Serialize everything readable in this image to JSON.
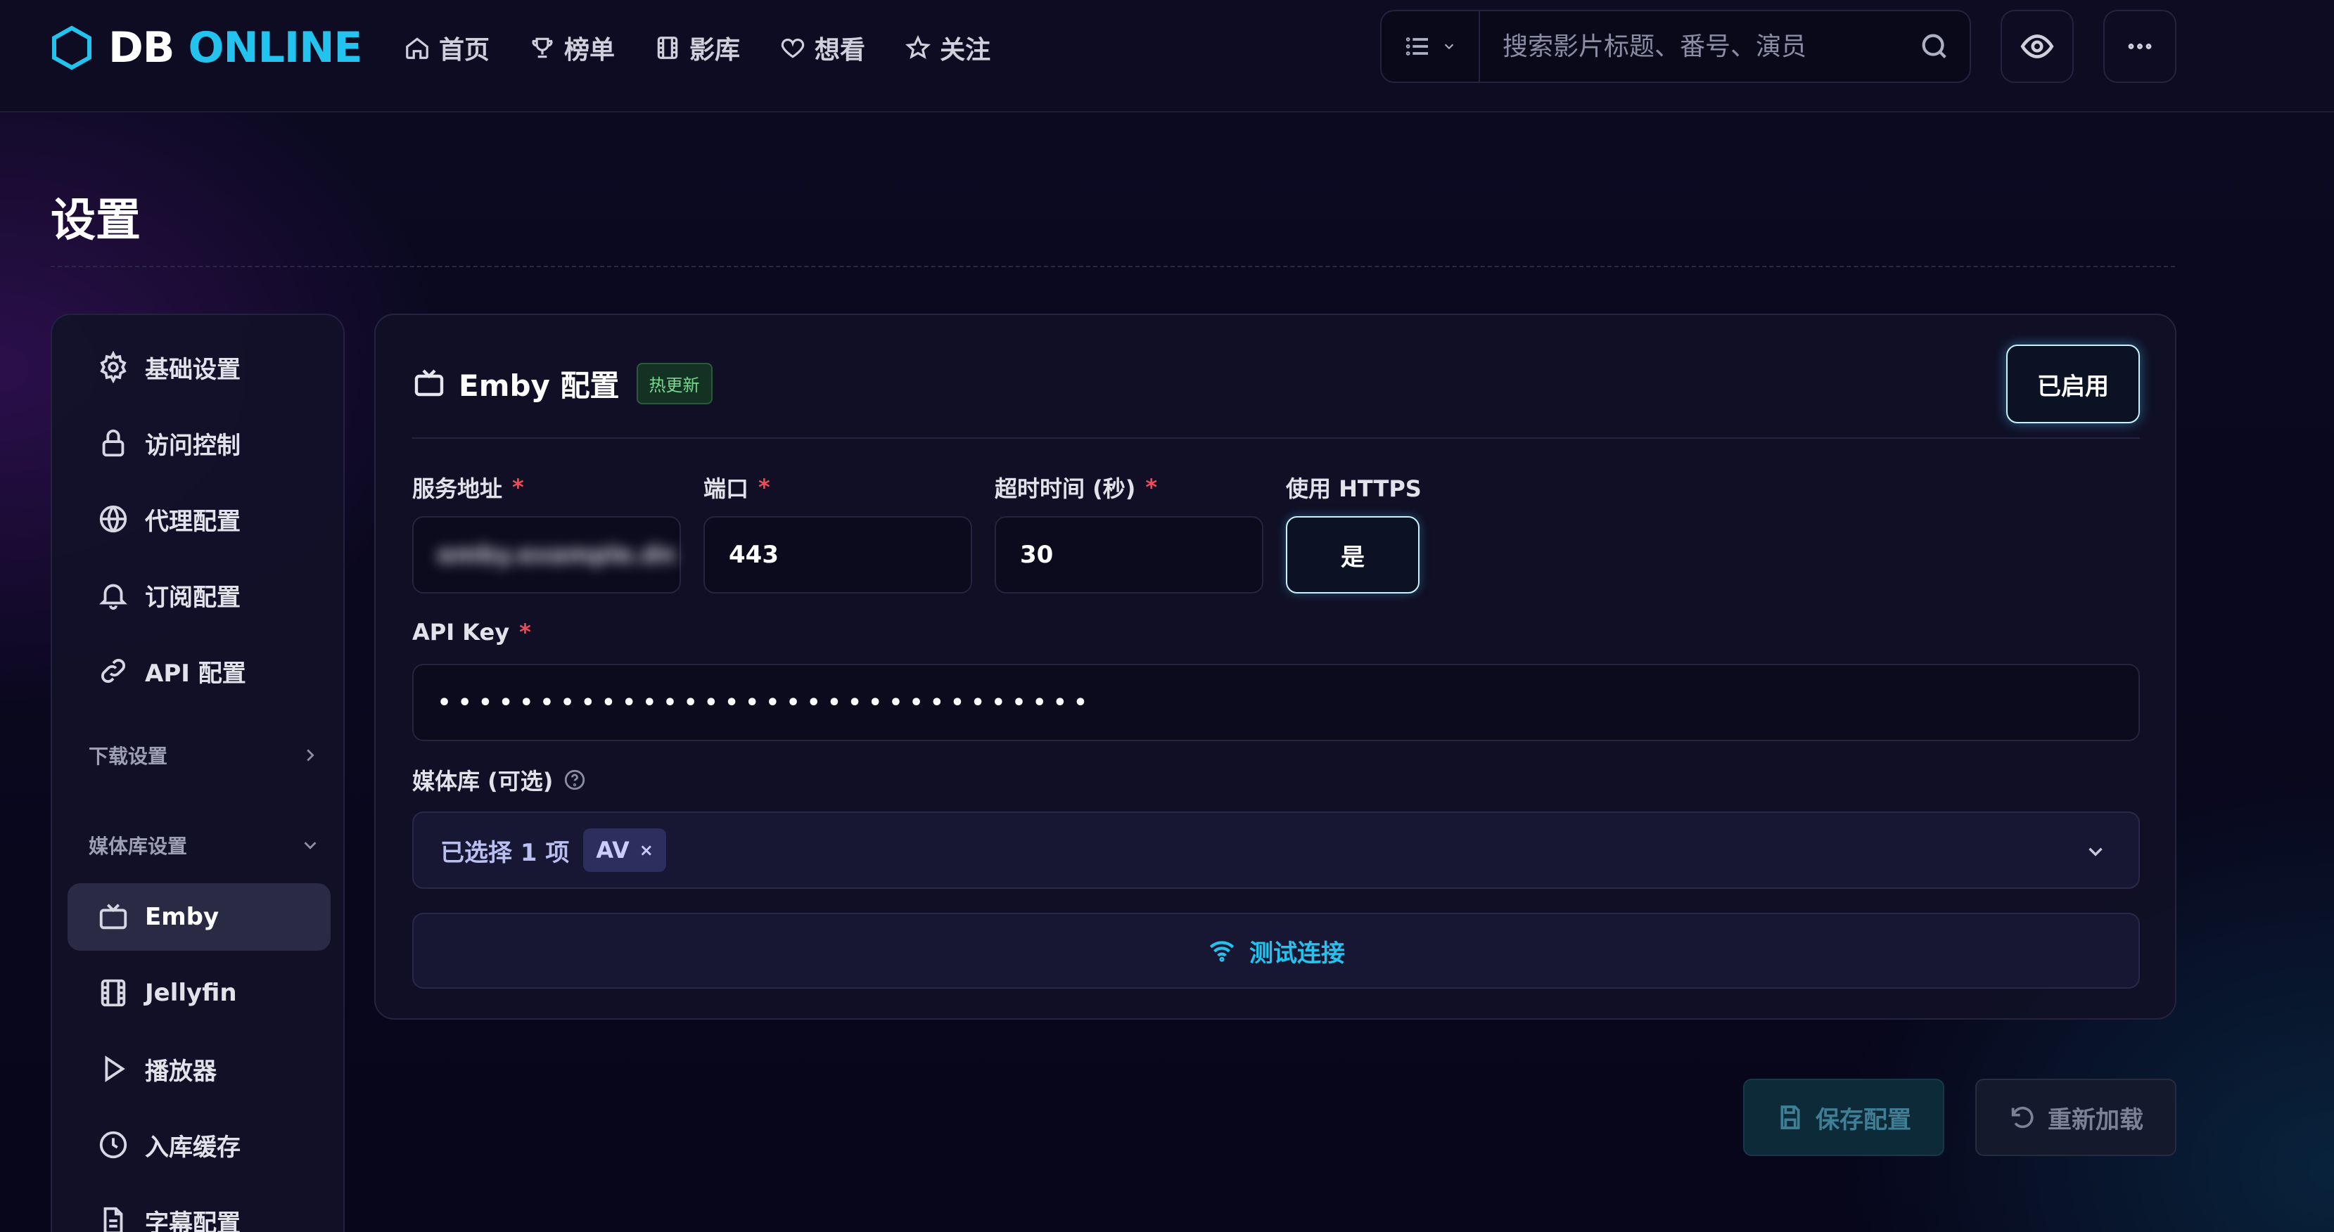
{
  "brand": {
    "part1": "DB",
    "part2": "ONLINE"
  },
  "nav": [
    {
      "label": "首页",
      "icon": "home-icon"
    },
    {
      "label": "榜单",
      "icon": "trophy-icon"
    },
    {
      "label": "影库",
      "icon": "film-icon"
    },
    {
      "label": "想看",
      "icon": "heart-icon"
    },
    {
      "label": "关注",
      "icon": "star-icon"
    }
  ],
  "search": {
    "placeholder": "搜索影片标题、番号、演员"
  },
  "page": {
    "title": "设置"
  },
  "sidebar": {
    "items": [
      {
        "label": "基础设置",
        "icon": "gear-icon"
      },
      {
        "label": "访问控制",
        "icon": "lock-icon"
      },
      {
        "label": "代理配置",
        "icon": "globe-icon"
      },
      {
        "label": "订阅配置",
        "icon": "bell-icon"
      },
      {
        "label": "API 配置",
        "icon": "link-icon"
      }
    ],
    "groups": [
      {
        "label": "下载设置"
      },
      {
        "label": "媒体库设置"
      }
    ],
    "media_items": [
      {
        "label": "Emby",
        "icon": "tv-icon",
        "active": true
      },
      {
        "label": "Jellyfin",
        "icon": "film-icon"
      },
      {
        "label": "播放器",
        "icon": "play-icon"
      },
      {
        "label": "入库缓存",
        "icon": "clock-icon"
      },
      {
        "label": "字幕配置",
        "icon": "file-icon"
      }
    ]
  },
  "card": {
    "title": "Emby 配置",
    "badge": "热更新",
    "enabled_label": "已启用",
    "fields": {
      "server": {
        "label": "服务地址",
        "required": "*",
        "value": "emby.example.dn"
      },
      "port": {
        "label": "端口",
        "required": "*",
        "value": "443"
      },
      "timeout": {
        "label": "超时时间 (秒)",
        "required": "*",
        "value": "30"
      },
      "https": {
        "label": "使用 HTTPS",
        "value": "是"
      },
      "api_key": {
        "label": "API Key",
        "required": "*",
        "value": "••••••••••••••••••••••••••••••••"
      },
      "library": {
        "label": "媒体库 (可选)",
        "selected_text": "已选择 1 项",
        "chip": "AV",
        "chip_remove": "×"
      }
    },
    "test_button": "测试连接"
  },
  "actions": {
    "save": "保存配置",
    "reload": "重新加载"
  },
  "colors": {
    "accent": "#22c3ee",
    "required": "#ef4a56",
    "badge_green": "#79d68f"
  }
}
